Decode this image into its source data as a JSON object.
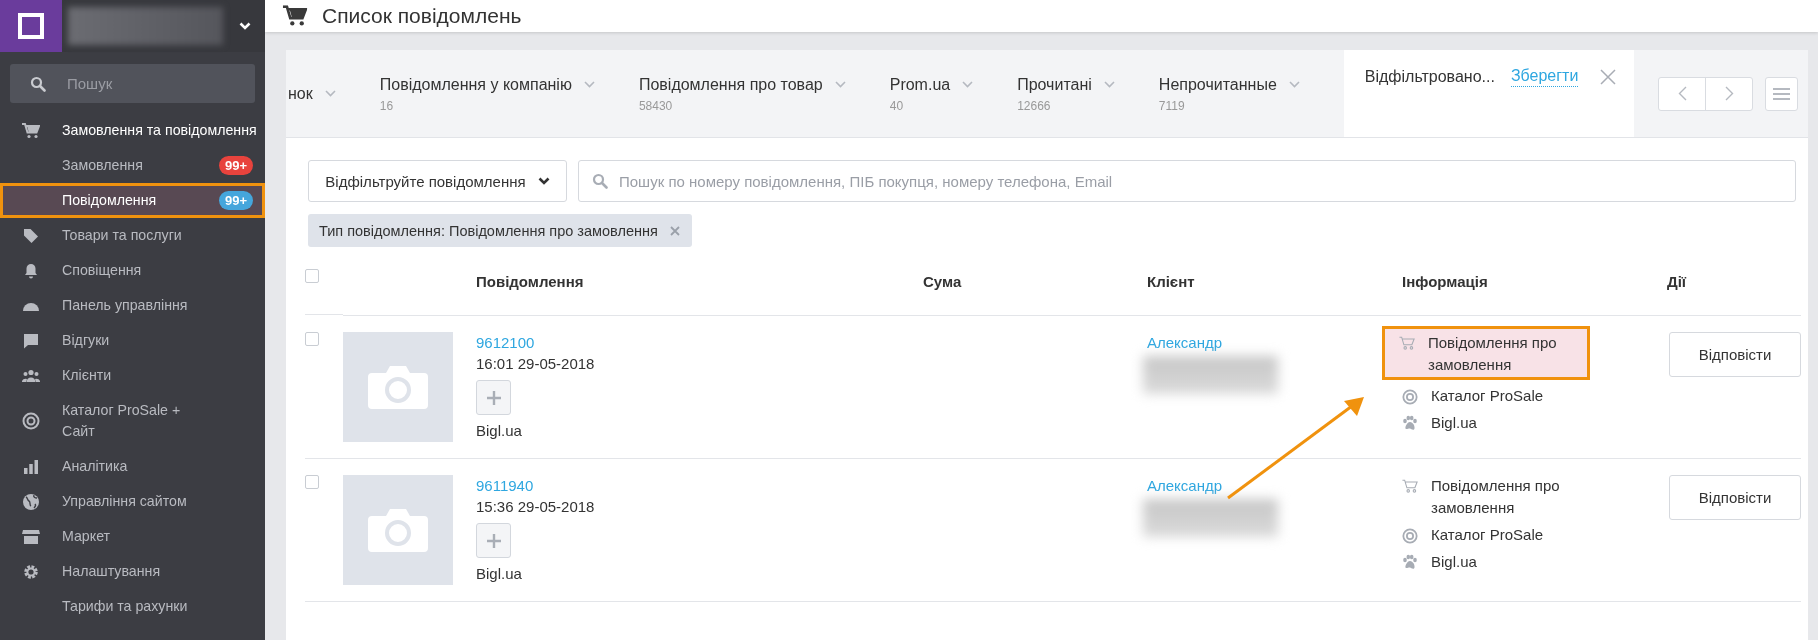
{
  "sidebar": {
    "search": {
      "placeholder": "Пошук"
    },
    "items": [
      {
        "label": "Замовлення та повідомлення",
        "expanded": true,
        "children": [
          {
            "label": "Замовлення",
            "selected": false,
            "highlighted": false,
            "badge": {
              "text": "99+",
              "color": "#e8433d"
            }
          },
          {
            "label": "Повідомлення",
            "selected": true,
            "highlighted": true,
            "badge": {
              "text": "99+",
              "color": "#45a6dc"
            }
          }
        ]
      },
      {
        "label": "Товари та послуги",
        "expanded": false
      },
      {
        "label": "Сповіщення",
        "expanded": false
      },
      {
        "label": "Панель управління",
        "expanded": false
      },
      {
        "label": "Відгуки",
        "expanded": false
      },
      {
        "label": "Клієнти",
        "expanded": false
      },
      {
        "label": "Каталог ProSale + Сайт",
        "expanded": false
      },
      {
        "label": "Аналітика",
        "expanded": false
      },
      {
        "label": "Управління сайтом",
        "expanded": false
      },
      {
        "label": "Маркет",
        "expanded": false
      },
      {
        "label": "Налаштування",
        "expanded": false
      },
      {
        "label": "Тарифи та рахунки",
        "expanded": false
      }
    ]
  },
  "page": {
    "title": "Список повідомлень"
  },
  "tabs": [
    {
      "label": "нок",
      "selected": false
    },
    {
      "label": "Повідомлення у компанію",
      "count": "16",
      "selected": false
    },
    {
      "label": "Повідомлення про товар",
      "count": "58430",
      "selected": false
    },
    {
      "label": "Prom.ua",
      "count": "40",
      "selected": false
    },
    {
      "label": "Прочитані",
      "count": "12666",
      "selected": false
    },
    {
      "label": "Непрочитанные",
      "count": "7119",
      "selected": false
    },
    {
      "label": "Відфільтровано...",
      "selected": true,
      "save_link": "Зберегти"
    }
  ],
  "filters": {
    "button": "Відфільтруйте повідомлення",
    "search_placeholder": "Пошук по номеру повідомлення, ПІБ покупця, номеру телефона, Email",
    "chips": [
      {
        "label": "Тип повідомлення: Повідомлення про замовлення"
      }
    ]
  },
  "table": {
    "select_all": {
      "checked": false
    },
    "columns": [
      "Повідомлення",
      "Сума",
      "Клієнт",
      "Інформація",
      "Дії"
    ],
    "rows": [
      {
        "checked": false,
        "number": "9612100",
        "datetime": "16:01 29-05-2018",
        "source": "Bigl.ua",
        "client": "Александр",
        "action": "Відповісти",
        "info": [
          {
            "kind": "type",
            "text": "Повідомлення про замовлення",
            "highlighted": true
          },
          {
            "kind": "catalog",
            "text": "Каталог ProSale",
            "highlighted": false
          },
          {
            "kind": "site",
            "text": "Bigl.ua",
            "highlighted": false
          }
        ]
      },
      {
        "checked": false,
        "number": "9611940",
        "datetime": "15:36 29-05-2018",
        "source": "Bigl.ua",
        "client": "Александр",
        "action": "Відповісти",
        "info": [
          {
            "kind": "type",
            "text": "Повідомлення про замовлення",
            "highlighted": false
          },
          {
            "kind": "catalog",
            "text": "Каталог ProSale",
            "highlighted": false
          },
          {
            "kind": "site",
            "text": "Bigl.ua",
            "highlighted": false
          }
        ]
      }
    ]
  }
}
